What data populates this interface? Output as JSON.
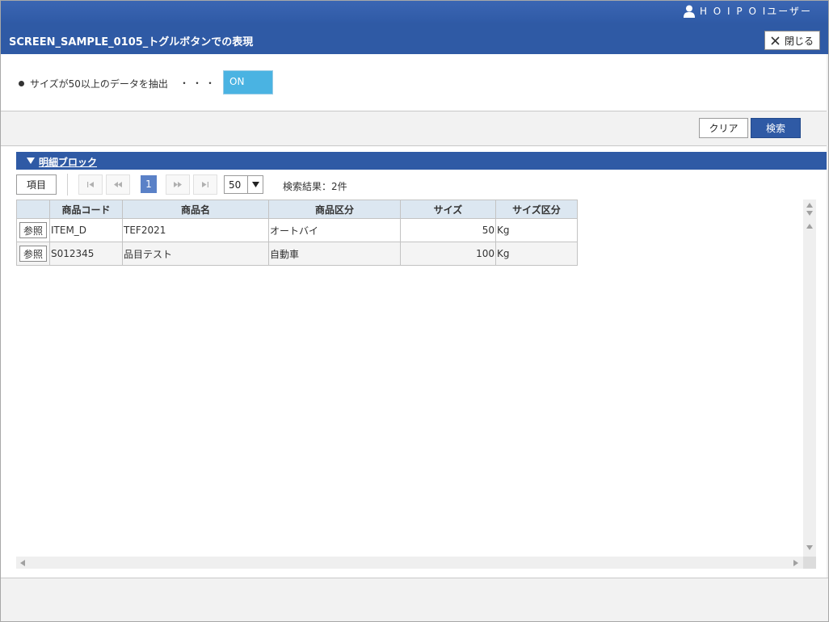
{
  "user": {
    "name": "H O I P O Iユーザー"
  },
  "window": {
    "title": "SCREEN_SAMPLE_0105_トグルボタンでの表現",
    "close_label": "閉じる"
  },
  "condition": {
    "label": "サイズが50以上のデータを抽出",
    "dots": "・・・",
    "toggle_value": "ON"
  },
  "toolbar": {
    "clear_label": "クリア",
    "search_label": "検索"
  },
  "block": {
    "title": "明細ブロック"
  },
  "pager": {
    "items_label": "項目",
    "current_page": "1",
    "page_size": "50",
    "result_text": "検索結果：2件"
  },
  "grid": {
    "columns": [
      "",
      "商品コード",
      "商品名",
      "商品区分",
      "サイズ",
      "サイズ区分"
    ],
    "ref_label": "参照",
    "rows": [
      {
        "code": "ITEM_D",
        "name": "TEF2021",
        "category": "オートバイ",
        "size": "50",
        "unit": "Kg"
      },
      {
        "code": "S012345",
        "name": "品目テスト",
        "category": "自動車",
        "size": "100",
        "unit": "Kg"
      }
    ]
  },
  "colors": {
    "header_blue": "#2f5aa5",
    "toggle_on": "#4ab3e2",
    "grid_header": "#dce7f1"
  }
}
